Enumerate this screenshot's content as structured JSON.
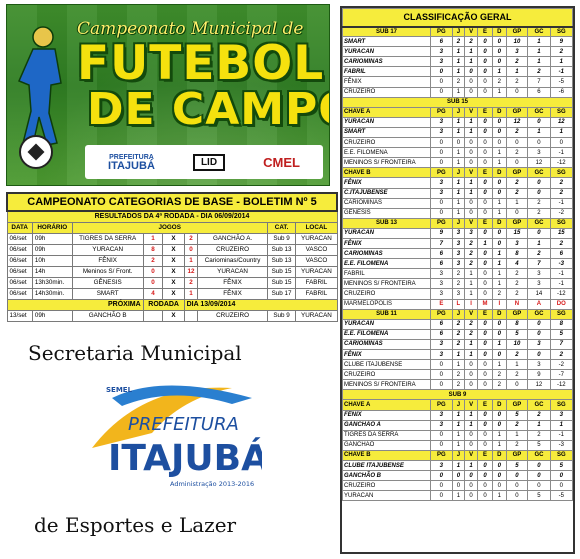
{
  "banner": {
    "title": "Campeonato Municipal de",
    "big_line1": "FUTEBOL",
    "big_line2": "DE CAMPO",
    "logo_pref_top": "PREFEITURA",
    "logo_pref_name": "ITAJUBÁ",
    "logo_lid": "LID",
    "logo_cmel": "CMEL"
  },
  "boletim": {
    "title": "CAMPEONATO   CATEGORIAS DE BASE  -  BOLETIM   Nº 5",
    "results_heading": "RESULTADOS DA 4ª RODADA  -  DIA 06/09/2014",
    "headers": [
      "DATA",
      "HORÁRIO",
      "JOGOS",
      "CAT.",
      "LOCAL"
    ],
    "results": [
      {
        "data": "06/set",
        "hora": "09h",
        "home": "TIGRES DA SERRA",
        "hs": "1",
        "as": "2",
        "away": "GANCHÃO A.",
        "cat": "Sub 9",
        "local": "YURACAN"
      },
      {
        "data": "06/set",
        "hora": "09h",
        "home": "YURACAN",
        "hs": "8",
        "as": "0",
        "away": "CRUZEIRO",
        "cat": "Sub 13",
        "local": "VASCO"
      },
      {
        "data": "06/set",
        "hora": "10h",
        "home": "FÊNIX",
        "hs": "2",
        "as": "1",
        "away": "Cariominas/Country",
        "cat": "Sub 13",
        "local": "VASCO"
      },
      {
        "data": "06/set",
        "hora": "14h",
        "home": "Meninos S/ Front.",
        "hs": "0",
        "as": "12",
        "away": "YURACAN",
        "cat": "Sub 15",
        "local": "YURACAN"
      },
      {
        "data": "06/set",
        "hora": "13h30min.",
        "home": "GÊNESIS",
        "hs": "0",
        "as": "2",
        "away": "FÊNIX",
        "cat": "Sub 15",
        "local": "FABRIL"
      },
      {
        "data": "06/set",
        "hora": "14h30min.",
        "home": "SMART",
        "hs": "4",
        "as": "1",
        "away": "FÊNIX",
        "cat": "Sub 17",
        "local": "FABRIL"
      }
    ],
    "next_heading_a": "PRÓXIMA",
    "next_heading_b": "RODADA",
    "next_heading_c": "DIA  13/09/2014",
    "next": [
      {
        "data": "13/set",
        "hora": "09h",
        "home": "GANCHÃO B",
        "x": "X",
        "away": "CRUZEIRO",
        "cat": "Sub 9",
        "local": "YURACAN"
      }
    ],
    "x_label": "X"
  },
  "secretaria": {
    "top": "Secretaria Municipal",
    "bottom": "de Esportes e Lazer",
    "logo_semel": "SEMEL",
    "logo_pref": "PREFEITURA",
    "logo_name": "ITAJUBÁ",
    "logo_admin": "Administração 2013-2016"
  },
  "classificacao": {
    "title": "CLASSIFICAÇÃO  GERAL",
    "col_headers": [
      "PG",
      "J",
      "V",
      "E",
      "D",
      "GP",
      "GC",
      "SG"
    ],
    "sections": [
      {
        "heading": "SUB  17",
        "rows": [
          {
            "team": "SMART",
            "vals": [
              "6",
              "2",
              "2",
              "0",
              "0",
              "10",
              "1",
              "9"
            ],
            "bi": true
          },
          {
            "team": "YURACAN",
            "vals": [
              "3",
              "1",
              "1",
              "0",
              "0",
              "3",
              "1",
              "2"
            ],
            "bi": true
          },
          {
            "team": "CARIOMINAS",
            "vals": [
              "3",
              "1",
              "1",
              "0",
              "0",
              "2",
              "1",
              "1"
            ],
            "bi": true
          },
          {
            "team": "FABRIL",
            "vals": [
              "0",
              "1",
              "0",
              "0",
              "1",
              "1",
              "2",
              "-1"
            ],
            "bi": true
          },
          {
            "team": "FÊNIX",
            "vals": [
              "0",
              "2",
              "0",
              "0",
              "2",
              "2",
              "7",
              "-5"
            ],
            "bi": false
          },
          {
            "team": "CRUZEIRO",
            "vals": [
              "0",
              "1",
              "0",
              "0",
              "1",
              "0",
              "6",
              "-6"
            ],
            "bi": false
          }
        ]
      },
      {
        "heading": "SUB  15",
        "chaves": [
          {
            "name": "CHAVE A",
            "rows": [
              {
                "team": "YURACAN",
                "vals": [
                  "3",
                  "1",
                  "1",
                  "0",
                  "0",
                  "12",
                  "0",
                  "12"
                ],
                "bi": true
              },
              {
                "team": "SMART",
                "vals": [
                  "3",
                  "1",
                  "1",
                  "0",
                  "0",
                  "2",
                  "1",
                  "1"
                ],
                "bi": true
              },
              {
                "team": "CRUZEIRO",
                "vals": [
                  "0",
                  "0",
                  "0",
                  "0",
                  "0",
                  "0",
                  "0",
                  "0"
                ],
                "bi": false
              },
              {
                "team": "E.E. FILOMENA",
                "vals": [
                  "0",
                  "1",
                  "0",
                  "0",
                  "1",
                  "2",
                  "3",
                  "-1"
                ],
                "bi": false
              },
              {
                "team": "MENINOS S/ FRONTEIRA",
                "vals": [
                  "0",
                  "1",
                  "0",
                  "0",
                  "1",
                  "0",
                  "12",
                  "-12"
                ],
                "bi": false
              }
            ]
          },
          {
            "name": "CHAVE B",
            "rows": [
              {
                "team": "FÊNIX",
                "vals": [
                  "3",
                  "1",
                  "1",
                  "0",
                  "0",
                  "2",
                  "0",
                  "2"
                ],
                "bi": true
              },
              {
                "team": "C.ITAJUBENSE",
                "vals": [
                  "3",
                  "1",
                  "1",
                  "0",
                  "0",
                  "2",
                  "0",
                  "2"
                ],
                "bi": true
              },
              {
                "team": "CARIOMINAS",
                "vals": [
                  "0",
                  "1",
                  "0",
                  "0",
                  "1",
                  "1",
                  "2",
                  "-1"
                ],
                "bi": false
              },
              {
                "team": "GÊNESIS",
                "vals": [
                  "0",
                  "1",
                  "0",
                  "0",
                  "1",
                  "0",
                  "2",
                  "-2"
                ],
                "bi": false
              }
            ]
          }
        ]
      },
      {
        "heading": "SUB  13",
        "rows": [
          {
            "team": "YURACAN",
            "vals": [
              "9",
              "3",
              "3",
              "0",
              "0",
              "15",
              "0",
              "15"
            ],
            "bi": true
          },
          {
            "team": "FÊNIX",
            "vals": [
              "7",
              "3",
              "2",
              "1",
              "0",
              "3",
              "1",
              "2"
            ],
            "bi": true
          },
          {
            "team": "CARIOMINAS",
            "vals": [
              "6",
              "3",
              "2",
              "0",
              "1",
              "8",
              "2",
              "6"
            ],
            "bi": true
          },
          {
            "team": "E.E. FILOMENA",
            "vals": [
              "6",
              "3",
              "2",
              "0",
              "1",
              "4",
              "7",
              "-3"
            ],
            "bi": true
          },
          {
            "team": "FABRIL",
            "vals": [
              "3",
              "2",
              "1",
              "0",
              "1",
              "2",
              "3",
              "-1"
            ],
            "bi": false
          },
          {
            "team": "MENINOS S/ FRONTEIRA",
            "vals": [
              "3",
              "2",
              "1",
              "0",
              "1",
              "2",
              "3",
              "-1"
            ],
            "bi": false
          },
          {
            "team": "CRUZEIRO",
            "vals": [
              "3",
              "3",
              "1",
              "0",
              "2",
              "2",
              "14",
              "-12"
            ],
            "bi": false
          }
        ],
        "eliminated": {
          "team": "MARMELÓPOLIS",
          "vals": [
            "E",
            "L",
            "I",
            "M",
            "I",
            "N",
            "A",
            "DO"
          ]
        }
      },
      {
        "heading": "SUB  11",
        "rows": [
          {
            "team": "YURACAN",
            "vals": [
              "6",
              "2",
              "2",
              "0",
              "0",
              "8",
              "0",
              "8"
            ],
            "bi": true
          },
          {
            "team": "E.E. FILOMENA",
            "vals": [
              "6",
              "2",
              "2",
              "0",
              "0",
              "5",
              "0",
              "5"
            ],
            "bi": true
          },
          {
            "team": "CARIOMINAS",
            "vals": [
              "3",
              "2",
              "1",
              "0",
              "1",
              "10",
              "3",
              "7"
            ],
            "bi": true
          },
          {
            "team": "FÊNIX",
            "vals": [
              "3",
              "1",
              "1",
              "0",
              "0",
              "2",
              "0",
              "2"
            ],
            "bi": true
          },
          {
            "team": "CLUBE ITAJUBENSE",
            "vals": [
              "0",
              "1",
              "0",
              "0",
              "1",
              "1",
              "3",
              "-2"
            ],
            "bi": false
          },
          {
            "team": "CRUZEIRO",
            "vals": [
              "0",
              "2",
              "0",
              "0",
              "2",
              "2",
              "9",
              "-7"
            ],
            "bi": false
          },
          {
            "team": "MENINOS S/ FRONTEIRA",
            "vals": [
              "0",
              "2",
              "0",
              "0",
              "2",
              "0",
              "12",
              "-12"
            ],
            "bi": false
          }
        ]
      },
      {
        "heading": "SUB  9",
        "chaves": [
          {
            "name": "CHAVE A",
            "rows": [
              {
                "team": "FÊNIX",
                "vals": [
                  "3",
                  "1",
                  "1",
                  "0",
                  "0",
                  "5",
                  "2",
                  "3"
                ],
                "bi": true
              },
              {
                "team": "GANCHÃO A",
                "vals": [
                  "3",
                  "1",
                  "1",
                  "0",
                  "0",
                  "2",
                  "1",
                  "1"
                ],
                "bi": true
              },
              {
                "team": "TIGRES DA SERRA",
                "vals": [
                  "0",
                  "1",
                  "0",
                  "0",
                  "1",
                  "1",
                  "2",
                  "-1"
                ],
                "bi": false
              },
              {
                "team": "GANCHÃO",
                "vals": [
                  "0",
                  "1",
                  "0",
                  "0",
                  "1",
                  "2",
                  "5",
                  "-3"
                ],
                "bi": false
              }
            ]
          },
          {
            "name": "CHAVE B",
            "rows": [
              {
                "team": "CLUBE ITAJUBENSE",
                "vals": [
                  "3",
                  "1",
                  "1",
                  "0",
                  "0",
                  "5",
                  "0",
                  "5"
                ],
                "bi": true
              },
              {
                "team": "GANCHÃO B",
                "vals": [
                  "0",
                  "0",
                  "0",
                  "0",
                  "0",
                  "0",
                  "0",
                  "0"
                ],
                "bi": true
              },
              {
                "team": "CRUZEIRO",
                "vals": [
                  "0",
                  "0",
                  "0",
                  "0",
                  "0",
                  "0",
                  "0",
                  "0"
                ],
                "bi": false
              },
              {
                "team": "YURACAN",
                "vals": [
                  "0",
                  "1",
                  "0",
                  "0",
                  "1",
                  "0",
                  "5",
                  "-5"
                ],
                "bi": false
              }
            ]
          }
        ]
      }
    ]
  },
  "colors": {
    "yellow": "#f6ec3c",
    "red": "#d61a1a",
    "grass": "#3f8e2c"
  }
}
